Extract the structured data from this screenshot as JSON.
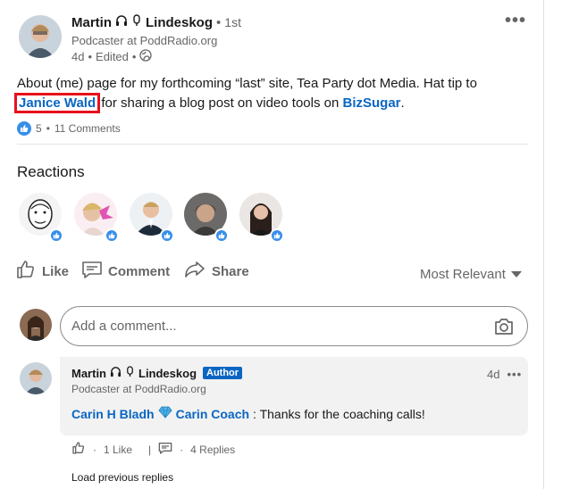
{
  "post": {
    "author_first": "Martin",
    "author_last": "Lindeskog",
    "degree": "1st",
    "headline": "Podcaster at PoddRadio.org",
    "age": "4d",
    "edited": "Edited",
    "more_label": "•••",
    "text_part1": "About (me) page for my forthcoming “last” site, Tea Party dot Media. Hat tip to",
    "mention1": "Janice Wald",
    "text_part2": "for sharing a blog post on video tools on",
    "mention2": "BizSugar",
    "text_part3": ".",
    "reaction_count": "5",
    "comments_count": "11 Comments"
  },
  "reactions": {
    "title": "Reactions"
  },
  "actions": {
    "like": "Like",
    "comment": "Comment",
    "share": "Share",
    "sort": "Most Relevant"
  },
  "comment_input": {
    "placeholder": "Add a comment..."
  },
  "comment": {
    "author_first": "Martin",
    "author_last": "Lindeskog",
    "author_tag": "Author",
    "headline": "Podcaster at PoddRadio.org",
    "time": "4d",
    "more_label": "•••",
    "mention1": "Carin H Bladh",
    "mention2": "Carin Coach",
    "text": ": Thanks for the coaching calls!",
    "likes": "1 Like",
    "replies": "4 Replies",
    "load_previous": "Load previous replies"
  },
  "colors": {
    "link": "#0a66c2",
    "like_blue": "#378fe9",
    "highlight_red": "#e8101b"
  }
}
